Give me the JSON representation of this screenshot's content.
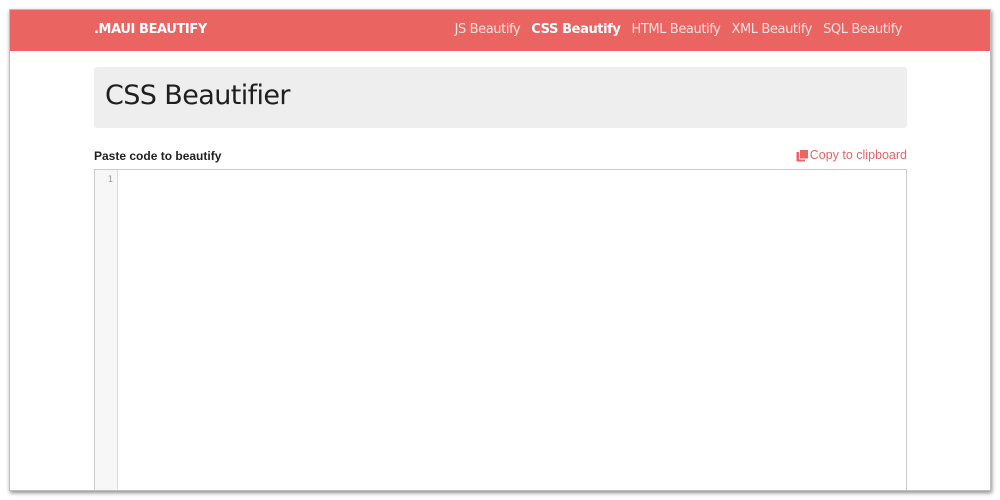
{
  "navbar": {
    "brand": ".MAUI BEAUTIFY",
    "links": [
      {
        "label": "JS Beautify",
        "active": false
      },
      {
        "label": "CSS Beautify",
        "active": true
      },
      {
        "label": "HTML Beautify",
        "active": false
      },
      {
        "label": "XML Beautify",
        "active": false
      },
      {
        "label": "SQL Beautify",
        "active": false
      }
    ]
  },
  "header": {
    "title": "CSS Beautifier"
  },
  "editor": {
    "label": "Paste code to beautify",
    "copy_label": "Copy to clipboard",
    "copy_icon": "copy-icon",
    "line_numbers": [
      "1"
    ],
    "content": ""
  },
  "colors": {
    "brand": "#ea6461",
    "nav_inactive": "#ffe0de",
    "jumbotron_bg": "#eeeeee",
    "gutter_bg": "#f7f7f7"
  }
}
